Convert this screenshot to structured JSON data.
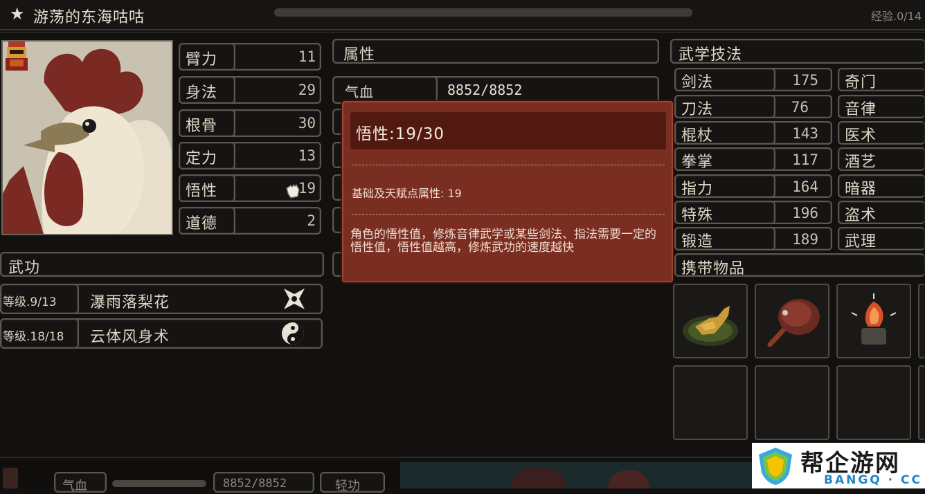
{
  "header": {
    "star": "★",
    "character_name": "游荡的东海咕咕",
    "exp_label": "经验.0/14",
    "exp_fraction": 0.0
  },
  "stats": [
    {
      "label": "臂力",
      "value": "11"
    },
    {
      "label": "身法",
      "value": "29"
    },
    {
      "label": "根骨",
      "value": "30"
    },
    {
      "label": "定力",
      "value": "13"
    },
    {
      "label": "悟性",
      "value": "19"
    },
    {
      "label": "道德",
      "value": "2"
    }
  ],
  "attributes": {
    "title": "属性",
    "hp_label": "气血",
    "hp_value": "8852/8852"
  },
  "tooltip": {
    "title": "悟性:19/30",
    "base_line": "基础及天赋点属性: 19",
    "description": "角色的悟性值，修炼音律武学或某些剑法、指法需要一定的悟性值，悟性值越高，修炼武功的速度越快"
  },
  "wugong": {
    "title": "武功",
    "items": [
      {
        "level": "等级.9/13",
        "name": "瀑雨落梨花",
        "icon": "shuriken-icon"
      },
      {
        "level": "等级.18/18",
        "name": "云体风身术",
        "icon": "yin-yang-icon"
      }
    ]
  },
  "martial_arts": {
    "title": "武学技法",
    "left": [
      {
        "label": "剑法",
        "value": "175"
      },
      {
        "label": "刀法",
        "value": "76"
      },
      {
        "label": "棍杖",
        "value": "143"
      },
      {
        "label": "拳掌",
        "value": "117"
      },
      {
        "label": "指力",
        "value": "164"
      },
      {
        "label": "特殊",
        "value": "196"
      },
      {
        "label": "锻造",
        "value": "189"
      }
    ],
    "right": [
      "奇门",
      "音律",
      "医术",
      "酒艺",
      "暗器",
      "盗术",
      "武理"
    ]
  },
  "inventory": {
    "title": "携带物品",
    "items": [
      "golden-rooster-icon",
      "roast-meat-icon",
      "fire-orb-icon"
    ]
  },
  "bottom_bar": {
    "hp_label": "气血",
    "hp_value": "8852/8852",
    "skill_label": "轻功"
  },
  "watermark": {
    "name": "帮企游网",
    "domain": "BANGQ · CC"
  },
  "colors": {
    "background": "#121110",
    "tooltip_bg": "#7a2e22",
    "tooltip_header": "#521910",
    "border": "#5b5750"
  }
}
